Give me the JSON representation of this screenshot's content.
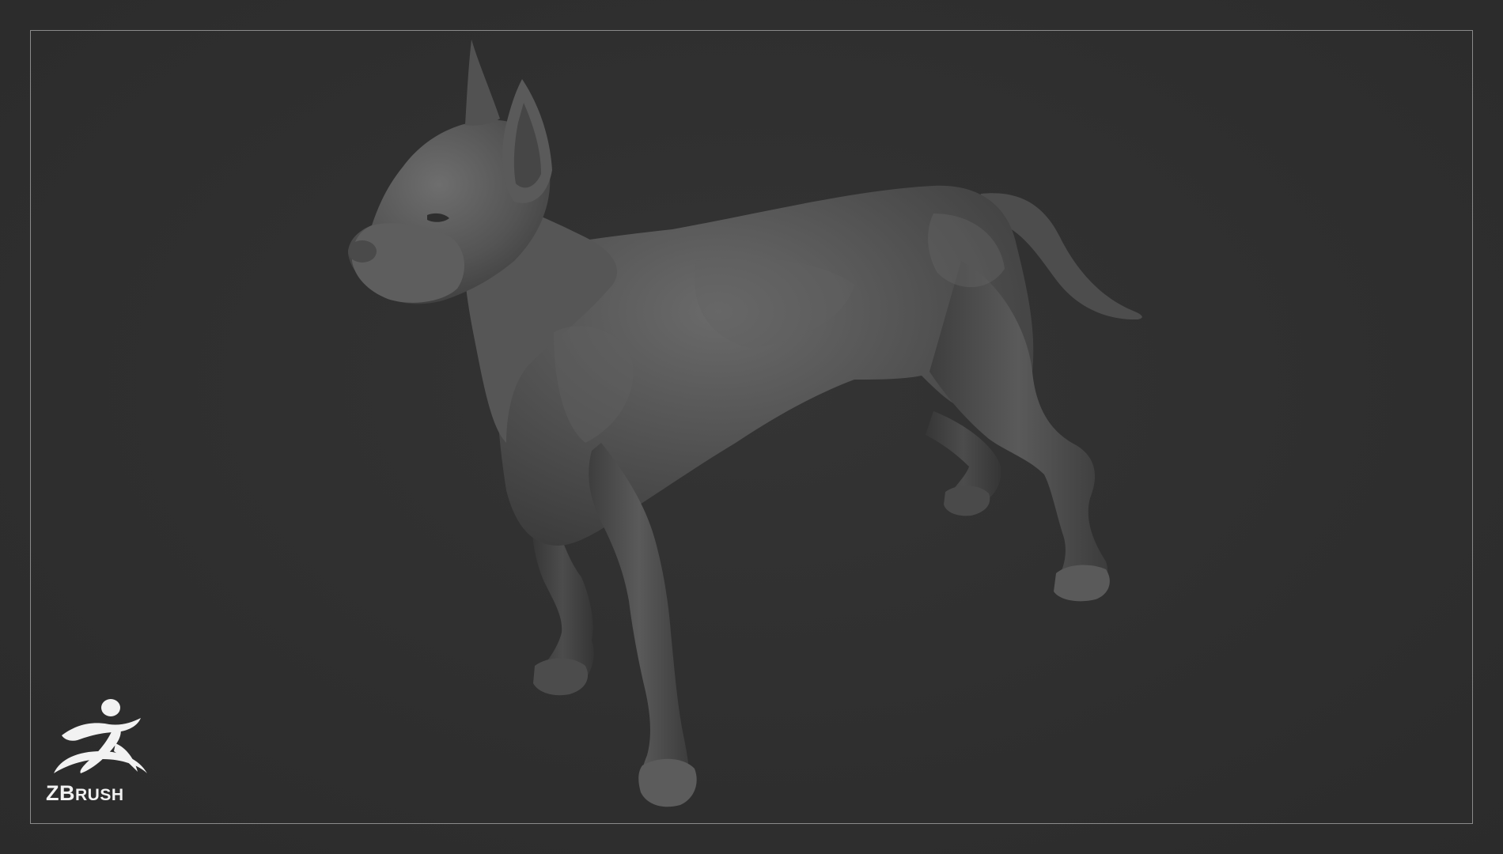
{
  "scene": {
    "background_color": "#2f2f2f",
    "frame_color": "#8a8a8a",
    "subject": "dog-sculpt"
  },
  "logo": {
    "word_big": "ZB",
    "word_small": "RUSH",
    "icon": "zbrush-runner-icon",
    "color": "#f2f2f2"
  }
}
